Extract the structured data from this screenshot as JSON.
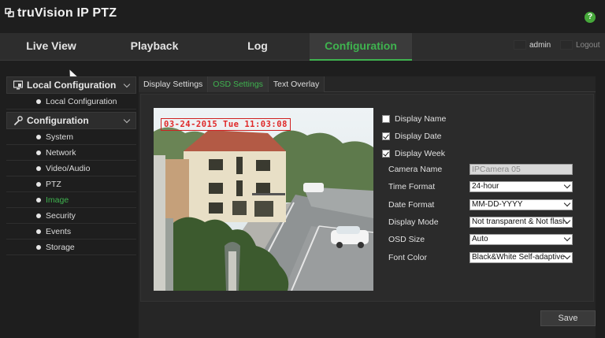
{
  "app": {
    "title": "truVision  IP PTZ",
    "help_label": "?"
  },
  "nav": {
    "tabs": [
      {
        "label": "Live View"
      },
      {
        "label": "Playback"
      },
      {
        "label": "Log"
      },
      {
        "label": "Configuration",
        "active": true
      }
    ],
    "user": "admin",
    "logout": "Logout"
  },
  "sidebar": {
    "sections": [
      {
        "label": "Local Configuration",
        "icon": "monitor-icon",
        "items": [
          {
            "label": "Local Configuration"
          }
        ]
      },
      {
        "label": "Configuration",
        "icon": "wrench-icon",
        "items": [
          {
            "label": "System"
          },
          {
            "label": "Network"
          },
          {
            "label": "Video/Audio"
          },
          {
            "label": "PTZ"
          },
          {
            "label": "Image",
            "active": true
          },
          {
            "label": "Security"
          },
          {
            "label": "Events"
          },
          {
            "label": "Storage"
          }
        ]
      }
    ]
  },
  "subtabs": [
    {
      "label": "Display Settings"
    },
    {
      "label": "OSD Settings",
      "active": true
    },
    {
      "label": "Text Overlay"
    }
  ],
  "osd": {
    "overlay_text": "03-24-2015 Tue 11:03:08",
    "display_name": {
      "label": "Display Name",
      "checked": false
    },
    "display_date": {
      "label": "Display Date",
      "checked": true
    },
    "display_week": {
      "label": "Display Week",
      "checked": true
    },
    "camera_name": {
      "label": "Camera Name",
      "value": "IPCamera 05"
    },
    "time_format": {
      "label": "Time Format",
      "value": "24-hour"
    },
    "date_format": {
      "label": "Date Format",
      "value": "MM-DD-YYYY"
    },
    "display_mode": {
      "label": "Display Mode",
      "value": "Not transparent & Not flash"
    },
    "osd_size": {
      "label": "OSD Size",
      "value": "Auto"
    },
    "font_color": {
      "label": "Font Color",
      "value": "Black&White Self-adaptive"
    }
  },
  "actions": {
    "save": "Save"
  },
  "colors": {
    "accent": "#3fb34f",
    "background": "#1e1e1e",
    "osd_text": "#e02828"
  }
}
